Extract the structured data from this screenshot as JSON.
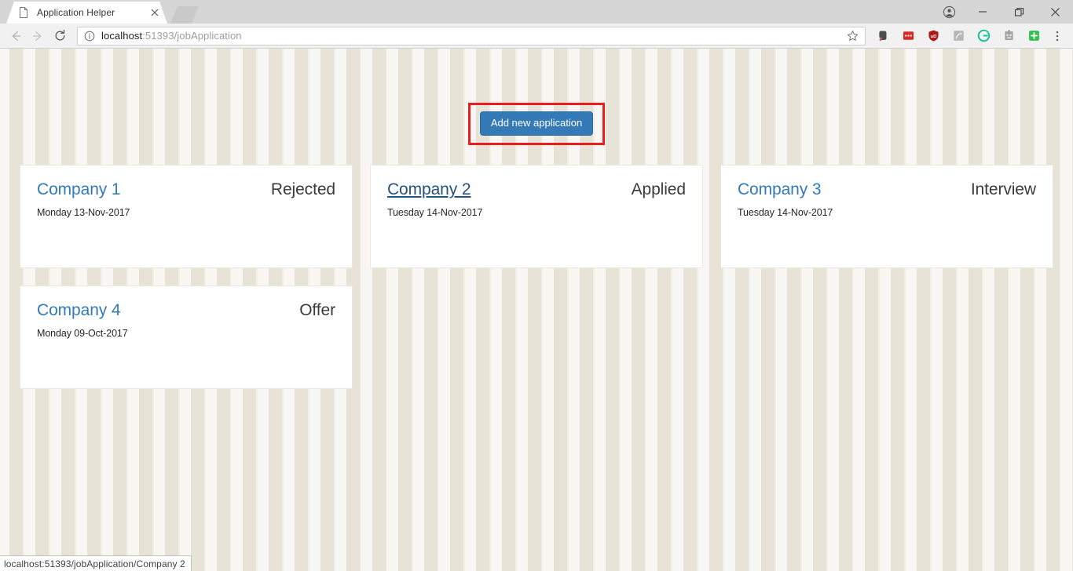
{
  "browser": {
    "tab": {
      "title": "Application Helper",
      "favicon_icon": "page-icon",
      "close_icon": "close-icon"
    },
    "new_tab_icon": "new-tab-button",
    "window_controls": {
      "profile_icon": "profile-avatar-icon",
      "minimize_icon": "minimize-icon",
      "maximize_icon": "maximize-restore-icon",
      "close_icon": "window-close-icon"
    },
    "nav": {
      "back_icon": "back-arrow-icon",
      "forward_icon": "forward-arrow-icon",
      "reload_icon": "reload-icon"
    },
    "omnibox": {
      "info_icon": "page-info-icon",
      "url_host": "localhost",
      "url_path": ":51393/jobApplication",
      "full_url": "localhost:51393/jobApplication",
      "bookmark_icon": "star-icon"
    },
    "extensions": [
      {
        "name": "evernote-extension-icon",
        "color": "#4a4a4a"
      },
      {
        "name": "lastpass-extension-icon",
        "color": "#d32d27"
      },
      {
        "name": "ublock-origin-extension-icon",
        "color": "#b01818"
      },
      {
        "name": "grayscale-extension-icon",
        "color": "#a8a8a8"
      },
      {
        "name": "grammarly-extension-icon",
        "color": "#15c39a"
      },
      {
        "name": "honey-extension-icon",
        "color": "#9e9e9e"
      },
      {
        "name": "add-extension-icon",
        "color": "#33c04f"
      }
    ],
    "menu_icon": "chrome-menu-icon"
  },
  "page": {
    "add_button_label": "Add new application",
    "highlight_color": "#ee1d1d",
    "accent_color": "#337ab7",
    "applications": [
      {
        "company": "Company 1",
        "status": "Rejected",
        "date": "Monday 13-Nov-2017",
        "hovered": false
      },
      {
        "company": "Company 2",
        "status": "Applied",
        "date": "Tuesday 14-Nov-2017",
        "hovered": true
      },
      {
        "company": "Company 3",
        "status": "Interview",
        "date": "Tuesday 14-Nov-2017",
        "hovered": false
      },
      {
        "company": "Company 4",
        "status": "Offer",
        "date": "Monday 09-Oct-2017",
        "hovered": false
      }
    ]
  },
  "statusbar": {
    "link_target": "localhost:51393/jobApplication/Company 2"
  }
}
